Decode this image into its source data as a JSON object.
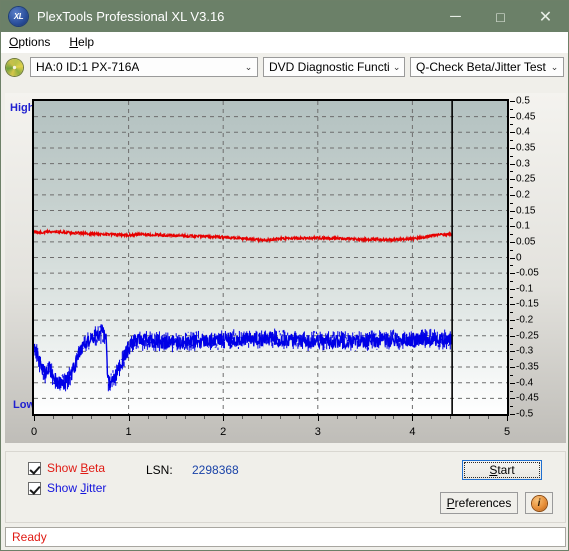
{
  "window": {
    "title": "PlexTools Professional XL V3.16",
    "icon": "app-xl-icon",
    "minimize": "─",
    "maximize": "□",
    "close": "✕",
    "titlebar_color": "#6b8068"
  },
  "menu": {
    "items": [
      {
        "label": "Options",
        "mnemonic": "O"
      },
      {
        "label": "Help",
        "mnemonic": "H"
      }
    ]
  },
  "toolbar": {
    "drive_icon": "disc-icon",
    "drive": "HA:0 ID:1  PX-716A",
    "function": "DVD Diagnostic Functions",
    "test": "Q-Check Beta/Jitter Test",
    "arrow": "⌄"
  },
  "chart_labels": {
    "high": "High",
    "low": "Low"
  },
  "controls": {
    "show_beta": {
      "label": "Show Beta",
      "mnemonic": "B",
      "checked": true,
      "color": "#e01b14"
    },
    "show_jitter": {
      "label": "Show Jitter",
      "mnemonic": "J",
      "checked": true,
      "color": "#1414dc"
    },
    "lsn_label": "LSN:",
    "lsn_value": "2298368",
    "start": {
      "label": "Start",
      "mnemonic": "S"
    },
    "preferences": {
      "label": "Preferences",
      "mnemonic": "P"
    },
    "info": {
      "glyph": "i",
      "name": "info-icon"
    }
  },
  "statusbar": {
    "text": "Ready"
  },
  "chart_data": {
    "type": "line",
    "title": "Q-Check Beta/Jitter Test",
    "xlabel": "",
    "ylabel": "",
    "xlim": [
      0,
      5
    ],
    "ylim": [
      -0.5,
      0.5
    ],
    "grid": true,
    "legend": "none",
    "xticks": [
      0,
      1,
      2,
      3,
      4,
      5
    ],
    "yticks": [
      0.5,
      0.45,
      0.4,
      0.35,
      0.3,
      0.25,
      0.2,
      0.15,
      0.1,
      0.05,
      0,
      -0.05,
      -0.1,
      -0.15,
      -0.2,
      -0.25,
      -0.3,
      -0.35,
      -0.4,
      -0.45,
      -0.5
    ],
    "ytick_labels": [
      "0.5",
      "0.45",
      "0.4",
      "0.35",
      "0.3",
      "0.25",
      "0.2",
      "0.15",
      "0.1",
      "0.05",
      "0",
      "-0.05",
      "-0.1",
      "-0.15",
      "-0.2",
      "-0.25",
      "-0.3",
      "-0.35",
      "-0.4",
      "-0.45",
      "-0.5"
    ],
    "left_axis_labels": [
      "High",
      "Low"
    ],
    "data_end_x": 4.42,
    "series": [
      {
        "name": "Beta",
        "color": "#e60000",
        "x": [
          0.0,
          0.05,
          0.1,
          0.15,
          0.2,
          0.25,
          0.3,
          0.35,
          0.4,
          0.45,
          0.5,
          0.55,
          0.6,
          0.65,
          0.7,
          0.75,
          0.8,
          0.85,
          0.9,
          0.95,
          1.0,
          1.1,
          1.2,
          1.3,
          1.4,
          1.5,
          1.6,
          1.7,
          1.8,
          1.9,
          2.0,
          2.1,
          2.2,
          2.3,
          2.4,
          2.5,
          2.6,
          2.7,
          2.8,
          2.9,
          3.0,
          3.1,
          3.2,
          3.3,
          3.4,
          3.5,
          3.6,
          3.7,
          3.8,
          3.9,
          4.0,
          4.1,
          4.2,
          4.3,
          4.42
        ],
        "y": [
          0.082,
          0.081,
          0.08,
          0.082,
          0.083,
          0.082,
          0.081,
          0.08,
          0.079,
          0.078,
          0.078,
          0.077,
          0.076,
          0.076,
          0.075,
          0.075,
          0.074,
          0.073,
          0.072,
          0.072,
          0.071,
          0.074,
          0.073,
          0.072,
          0.071,
          0.07,
          0.069,
          0.068,
          0.067,
          0.066,
          0.065,
          0.063,
          0.061,
          0.058,
          0.056,
          0.057,
          0.06,
          0.061,
          0.062,
          0.062,
          0.063,
          0.062,
          0.061,
          0.06,
          0.059,
          0.058,
          0.058,
          0.057,
          0.057,
          0.058,
          0.06,
          0.064,
          0.069,
          0.073,
          0.074
        ],
        "noise": 0.004
      },
      {
        "name": "Jitter",
        "color": "#0000e6",
        "x": [
          0.0,
          0.04,
          0.08,
          0.12,
          0.16,
          0.2,
          0.24,
          0.28,
          0.32,
          0.36,
          0.4,
          0.44,
          0.48,
          0.52,
          0.56,
          0.6,
          0.64,
          0.68,
          0.72,
          0.76,
          0.78,
          0.8,
          0.84,
          0.88,
          0.92,
          0.96,
          1.0,
          1.05,
          1.1,
          1.2,
          1.3,
          1.4,
          1.5,
          1.6,
          1.7,
          1.8,
          1.9,
          2.0,
          2.1,
          2.2,
          2.3,
          2.4,
          2.5,
          2.6,
          2.7,
          2.8,
          2.9,
          3.0,
          3.1,
          3.2,
          3.3,
          3.4,
          3.5,
          3.6,
          3.7,
          3.8,
          3.9,
          4.0,
          4.1,
          4.2,
          4.3,
          4.42
        ],
        "y": [
          -0.285,
          -0.315,
          -0.355,
          -0.372,
          -0.35,
          -0.378,
          -0.395,
          -0.405,
          -0.4,
          -0.39,
          -0.37,
          -0.34,
          -0.305,
          -0.282,
          -0.27,
          -0.262,
          -0.252,
          -0.246,
          -0.243,
          -0.245,
          -0.395,
          -0.398,
          -0.39,
          -0.37,
          -0.34,
          -0.31,
          -0.285,
          -0.272,
          -0.266,
          -0.265,
          -0.268,
          -0.27,
          -0.271,
          -0.27,
          -0.268,
          -0.266,
          -0.265,
          -0.263,
          -0.262,
          -0.262,
          -0.263,
          -0.262,
          -0.258,
          -0.262,
          -0.264,
          -0.265,
          -0.266,
          -0.266,
          -0.267,
          -0.268,
          -0.268,
          -0.267,
          -0.266,
          -0.265,
          -0.264,
          -0.263,
          -0.262,
          -0.262,
          -0.261,
          -0.261,
          -0.262,
          -0.262
        ],
        "noise": 0.022
      }
    ]
  }
}
